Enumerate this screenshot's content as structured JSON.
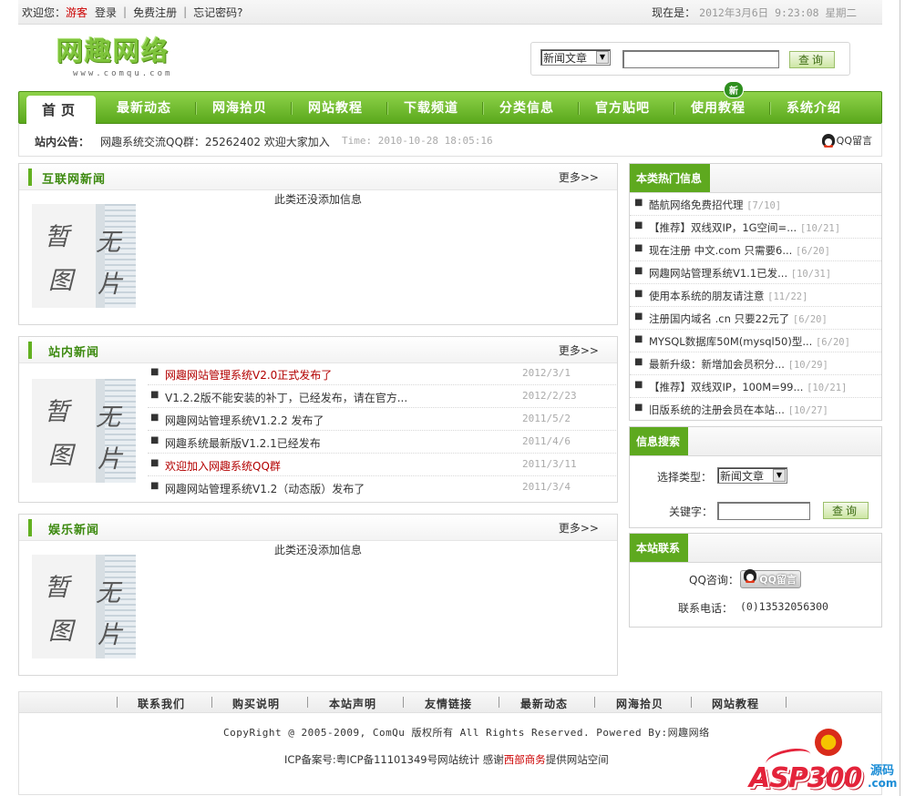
{
  "topbar": {
    "welcome": "欢迎您：",
    "guest": "游客",
    "login": "登录",
    "sep": "|",
    "register": "免费注册",
    "forgot": "忘记密码?",
    "now_label": "现在是：",
    "datetime": "2012年3月6日 9:23:08 星期二"
  },
  "logo": {
    "text": "网趣网络",
    "sub": "www.comqu.com"
  },
  "search": {
    "category": "新闻文章",
    "button": "查询",
    "keyword": ""
  },
  "nav": {
    "home": "首页",
    "items": [
      "最新动态",
      "网海拾贝",
      "网站教程",
      "下载频道",
      "分类信息",
      "官方贴吧",
      "使用教程",
      "系统介绍"
    ],
    "badge": "新"
  },
  "notice": {
    "label": "站内公告：",
    "text": "网趣系统交流QQ群：25262402 欢迎大家加入",
    "time": "Time: 2010-10-28 18:05:16",
    "qq": "QQ留言"
  },
  "no_image": {
    "chars": [
      "暂",
      "无",
      "图",
      "片"
    ]
  },
  "panels": {
    "internet": {
      "title": "互联网新闻",
      "more": "更多>>",
      "empty": "此类还没添加信息"
    },
    "site": {
      "title": "站内新闻",
      "more": "更多>>",
      "items": [
        {
          "title": "网趣网站管理系统V2.0正式发布了",
          "date": "2012/3/1",
          "highlight": true
        },
        {
          "title": "V1.2.2版不能安装的补丁，已经发布，请在官方...",
          "date": "2012/2/23",
          "highlight": false
        },
        {
          "title": "网趣网站管理系统V1.2.2 发布了",
          "date": "2011/5/2",
          "highlight": false
        },
        {
          "title": "网趣系统最新版V1.2.1已经发布",
          "date": "2011/4/6",
          "highlight": false
        },
        {
          "title": "欢迎加入网趣系统QQ群",
          "date": "2011/3/11",
          "highlight": true
        },
        {
          "title": "网趣网站管理系统V1.2（动态版）发布了",
          "date": "2011/3/4",
          "highlight": false
        }
      ]
    },
    "entertainment": {
      "title": "娱乐新闻",
      "more": "更多>>",
      "empty": "此类还没添加信息"
    }
  },
  "hot": {
    "title": "本类热门信息",
    "items": [
      {
        "title": "酷航网络免费招代理",
        "count": "[7/10]"
      },
      {
        "title": "【推荐】双线双IP，1G空间=...",
        "count": "[10/21]"
      },
      {
        "title": "现在注册 中文.com 只需要6...",
        "count": "[6/20]"
      },
      {
        "title": "网趣网站管理系统V1.1已发...",
        "count": "[10/31]"
      },
      {
        "title": "使用本系统的朋友请注意",
        "count": "[11/22]"
      },
      {
        "title": "注册国内域名 .cn 只要22元了",
        "count": "[6/20]"
      },
      {
        "title": "MYSQL数据库50M(mysql50)型...",
        "count": "[6/20]"
      },
      {
        "title": "最新升级：新增加会员积分...",
        "count": "[10/29]"
      },
      {
        "title": "【推荐】双线双IP，100M=99...",
        "count": "[10/21]"
      },
      {
        "title": "旧版系统的注册会员在本站...",
        "count": "[10/27]"
      }
    ]
  },
  "info_search": {
    "title": "信息搜索",
    "type_label": "选择类型：",
    "type_value": "新闻文章",
    "keyword_label": "关键字：",
    "button": "查询"
  },
  "contact": {
    "title": "本站联系",
    "qq_label": "QQ咨询：",
    "qq_button": "QQ留言",
    "phone_label": "联系电话：",
    "phone": "(0)13532056300"
  },
  "footer": {
    "links": [
      "联系我们",
      "购买说明",
      "本站声明",
      "友情链接",
      "最新动态",
      "网海拾贝",
      "网站教程"
    ],
    "copyright": "CopyRight @ 2005-2009, ComQu 版权所有 All Rights Reserved. Powered By:网趣网络",
    "icp_prefix": "ICP备案号:粤ICP备11101349号网站统计   感谢",
    "icp_red": "西部商务",
    "icp_suffix": "提供网站空间"
  },
  "watermark": {
    "brand": "ASP300",
    "tag": "源码",
    "domain": ".com"
  },
  "colors": {
    "accent_green": "#5ea91f",
    "title_green": "#3d8a10",
    "highlight_red": "#b30000"
  }
}
